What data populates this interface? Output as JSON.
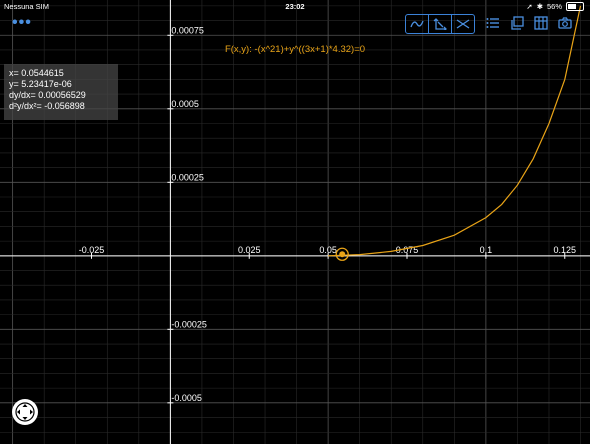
{
  "status": {
    "carrier": "Nessuna SIM",
    "time": "23:02",
    "battery": "56%",
    "battery_level": 0.56
  },
  "toolbar": {
    "menu_label": "•••",
    "modes": [
      {
        "icon": "trace-curve-icon"
      },
      {
        "icon": "tangent-icon"
      },
      {
        "icon": "intersection-icon"
      }
    ],
    "tools": [
      {
        "icon": "list-icon"
      },
      {
        "icon": "copy-icon"
      },
      {
        "icon": "library-icon"
      },
      {
        "icon": "camera-icon"
      }
    ]
  },
  "formula": "F(x,y): -(x^21)+y^((3x+1)*4.32)=0",
  "trace": {
    "x_label": "x=  0.0544615",
    "y_label": "y=  5.23417e-06",
    "dydx_label": "dy/dx=  0.00056529",
    "d2ydx2_label": "d²y/dx²= -0.056898"
  },
  "chart_data": {
    "type": "line",
    "title": "",
    "xlabel": "",
    "ylabel": "",
    "xlim": [
      -0.054,
      0.133
    ],
    "ylim": [
      -0.00064,
      0.00087
    ],
    "x_ticks": [
      -0.025,
      0.025,
      0.05,
      0.075,
      0.1,
      0.125
    ],
    "x_tick_labels": [
      "-0.025",
      "0.025",
      "0.05",
      "0.075",
      "0.1",
      "0.125"
    ],
    "y_ticks": [
      0.00075,
      0.0005,
      0.00025,
      -0.00025,
      -0.0005
    ],
    "y_tick_labels": [
      "0.00075",
      "0.0005",
      "0.00025",
      "-0.00025",
      "-0.0005"
    ],
    "grid": true,
    "series": [
      {
        "color": "#e8a317",
        "x": [
          0.05,
          0.06,
          0.07,
          0.08,
          0.09,
          0.1,
          0.105,
          0.11,
          0.115,
          0.12,
          0.125,
          0.13
        ],
        "y": [
          0.0,
          4e-06,
          1.5e-05,
          3.5e-05,
          7e-05,
          0.00013,
          0.000175,
          0.00024,
          0.00033,
          0.00045,
          0.0006,
          0.00085
        ]
      }
    ],
    "trace_point": {
      "x": 0.0544615,
      "y": 5.23417e-06,
      "color": "#e8a317"
    }
  }
}
